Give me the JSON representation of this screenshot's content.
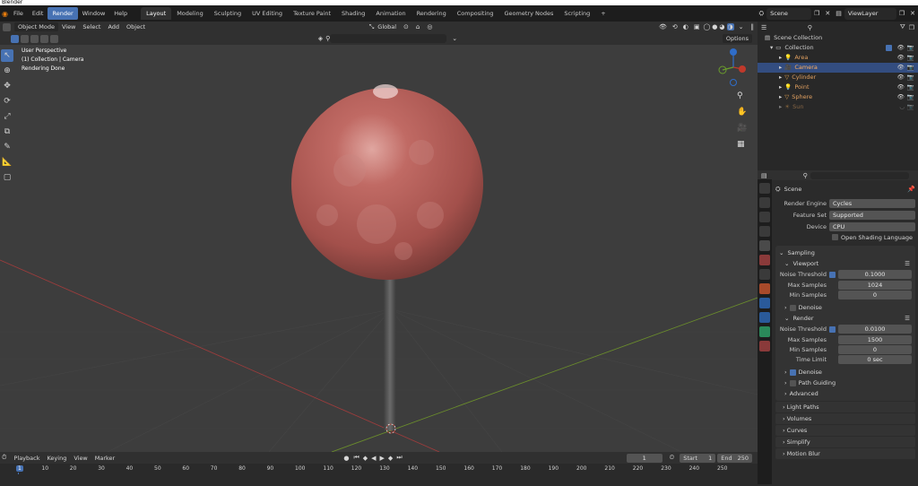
{
  "window": {
    "title": "Blender"
  },
  "menu": {
    "items": [
      "File",
      "Edit",
      "Render",
      "Window",
      "Help"
    ],
    "active_item": "Render"
  },
  "workspaces": {
    "tabs": [
      "Layout",
      "Modeling",
      "Sculpting",
      "UV Editing",
      "Texture Paint",
      "Shading",
      "Animation",
      "Rendering",
      "Compositing",
      "Geometry Nodes",
      "Scripting"
    ],
    "active": "Layout",
    "add": "+"
  },
  "scene_selector": {
    "value": "Scene"
  },
  "viewlayer_selector": {
    "value": "ViewLayer"
  },
  "viewport_header": {
    "mode": "Object Mode",
    "menus": [
      "View",
      "Select",
      "Add",
      "Object"
    ],
    "transform_orientation": "Global",
    "options": "Options"
  },
  "viewport": {
    "overlay": [
      "User Perspective",
      "(1) Collection | Camera",
      "Rendering Done"
    ],
    "colors": {
      "background": "#3d3d3d",
      "sphere": "#b35a55",
      "x_axis": "#9a3c3c",
      "y_axis": "#6a8c2c"
    }
  },
  "outliner": {
    "root": "Scene Collection",
    "collection": "Collection",
    "items": [
      {
        "name": "Area",
        "type": "light"
      },
      {
        "name": "Camera",
        "type": "camera",
        "selected": true
      },
      {
        "name": "Cylinder",
        "type": "mesh"
      },
      {
        "name": "Point",
        "type": "light"
      },
      {
        "name": "Sphere",
        "type": "mesh"
      },
      {
        "name": "Sun",
        "type": "light",
        "disabled": true
      }
    ]
  },
  "properties": {
    "context": "Scene",
    "render_engine_label": "Render Engine",
    "render_engine": "Cycles",
    "feature_set_label": "Feature Set",
    "feature_set": "Supported",
    "device_label": "Device",
    "device": "CPU",
    "osl_label": "Open Shading Language",
    "sampling": {
      "title": "Sampling",
      "viewport": {
        "title": "Viewport",
        "noise_threshold_label": "Noise Threshold",
        "noise_threshold": "0.1000",
        "max_samples_label": "Max Samples",
        "max_samples": "1024",
        "min_samples_label": "Min Samples",
        "min_samples": "0",
        "denoise": "Denoise"
      },
      "render": {
        "title": "Render",
        "noise_threshold_label": "Noise Threshold",
        "noise_threshold": "0.0100",
        "max_samples_label": "Max Samples",
        "max_samples": "1500",
        "min_samples_label": "Min Samples",
        "min_samples": "0",
        "time_limit_label": "Time Limit",
        "time_limit": "0 sec",
        "denoise": "Denoise",
        "path_guiding": "Path Guiding",
        "advanced": "Advanced"
      }
    },
    "panels": [
      "Light Paths",
      "Volumes",
      "Curves",
      "Simplify",
      "Motion Blur"
    ]
  },
  "timeline": {
    "menus": [
      "Playback",
      "Keying",
      "View",
      "Marker"
    ],
    "current_frame": "1",
    "start_label": "Start",
    "start": "1",
    "end_label": "End",
    "end": "250",
    "ticks": [
      "1",
      "10",
      "20",
      "30",
      "40",
      "50",
      "60",
      "70",
      "80",
      "90",
      "100",
      "110",
      "120",
      "130",
      "140",
      "150",
      "160",
      "170",
      "180",
      "190",
      "200",
      "210",
      "220",
      "230",
      "240",
      "250"
    ]
  }
}
